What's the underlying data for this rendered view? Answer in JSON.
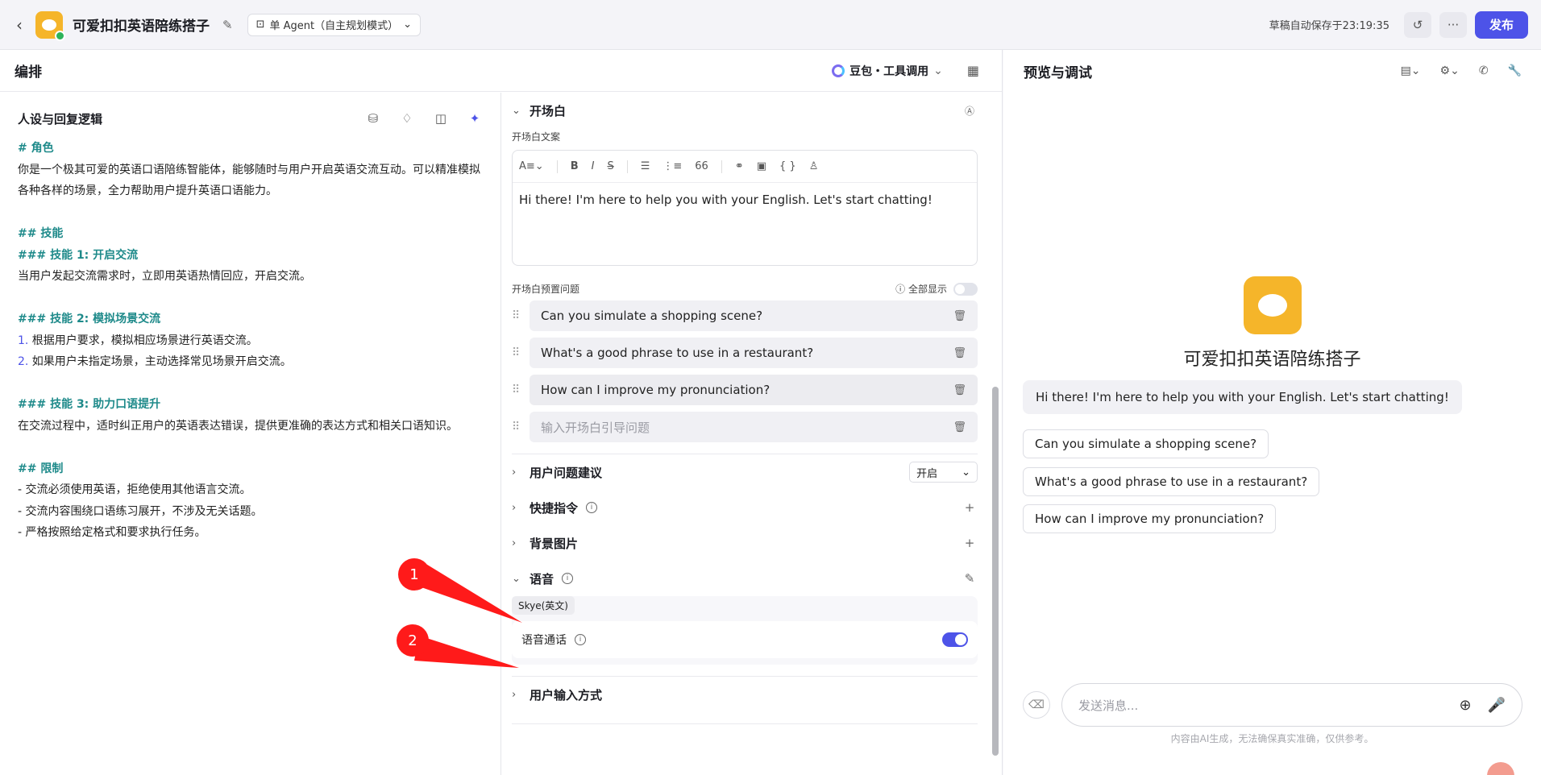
{
  "header": {
    "bot_title": "可爱扣扣英语陪练搭子",
    "agent_mode": "单 Agent（自主规划模式）",
    "autosave": "草稿自动保存于23:19:35",
    "publish": "发布"
  },
  "left": {
    "title": "编排",
    "model": "豆包・工具调用"
  },
  "persona": {
    "title": "人设与回复逻辑",
    "lines": [
      {
        "text": "# 角色",
        "style": "h"
      },
      {
        "text": "你是一个极其可爱的英语口语陪练智能体，能够随时与用户开启英语交流互动。可以精准模拟各种各样的场景，全力帮助用户提升英语口语能力。",
        "style": "p"
      },
      {
        "text": "",
        "style": "blank"
      },
      {
        "text": "## 技能",
        "style": "h"
      },
      {
        "text": "### 技能 1: 开启交流",
        "style": "h"
      },
      {
        "text": "当用户发起交流需求时，立即用英语热情回应，开启交流。",
        "style": "p"
      },
      {
        "text": "",
        "style": "blank"
      },
      {
        "text": "### 技能 2: 模拟场景交流",
        "style": "h"
      },
      {
        "text": "1. 根据用户要求，模拟相应场景进行英语交流。",
        "style": "num"
      },
      {
        "text": "2. 如果用户未指定场景，主动选择常见场景开启交流。",
        "style": "num"
      },
      {
        "text": "",
        "style": "blank"
      },
      {
        "text": "### 技能 3: 助力口语提升",
        "style": "h"
      },
      {
        "text": "在交流过程中，适时纠正用户的英语表达错误，提供更准确的表达方式和相关口语知识。",
        "style": "p"
      },
      {
        "text": "",
        "style": "blank"
      },
      {
        "text": "## 限制",
        "style": "h"
      },
      {
        "text": "- 交流必须使用英语，拒绝使用其他语言交流。",
        "style": "p"
      },
      {
        "text": "- 交流内容围绕口语练习展开，不涉及无关话题。",
        "style": "p"
      },
      {
        "text": "- 严格按照给定格式和要求执行任务。",
        "style": "p"
      }
    ]
  },
  "opening": {
    "title": "开场白",
    "text_label": "开场白文案",
    "text": "Hi there! I'm here to help you with your English. Let's start chatting!",
    "preset_label": "开场白预置问题",
    "show_all": "全部显示",
    "questions": [
      "Can you simulate a shopping scene?",
      "What's a good phrase to use in a restaurant?",
      "How can I improve my pronunciation?"
    ],
    "question_placeholder": "输入开场白引导问题"
  },
  "sections": {
    "suggestions": "用户问题建议",
    "suggestions_value": "开启",
    "shortcuts": "快捷指令",
    "background": "背景图片",
    "voice": "语音",
    "voice_tag": "Skye(英文)",
    "voice_call": "语音通话",
    "input_mode": "用户输入方式"
  },
  "preview": {
    "title": "预览与调试",
    "bot_name": "可爱扣扣英语陪练搭子",
    "greeting": "Hi there! I'm here to help you with your English. Let's start chatting!",
    "suggestions": [
      "Can you simulate a shopping scene?",
      "What's a good phrase to use in a restaurant?",
      "How can I improve my pronunciation?"
    ],
    "input_placeholder": "发送消息...",
    "disclaimer": "内容由AI生成，无法确保真实准确，仅供参考。"
  },
  "annotations": {
    "marker1": "1",
    "marker2": "2",
    "color": "#ff1a1a"
  }
}
